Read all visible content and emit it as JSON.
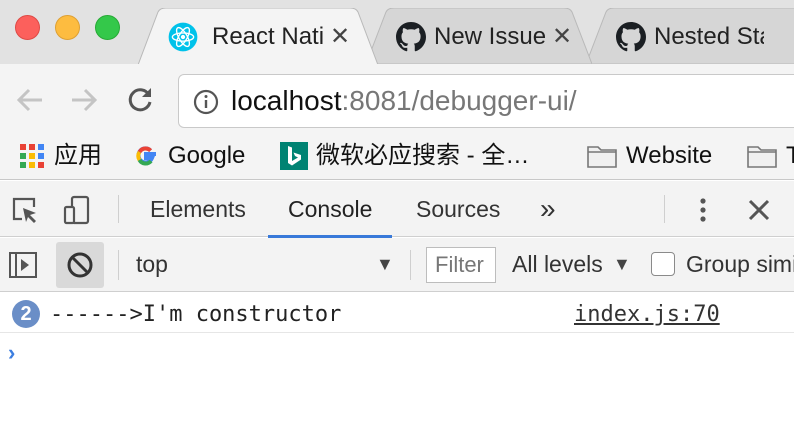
{
  "window": {
    "traffic_lights": [
      "close",
      "minimize",
      "zoom"
    ]
  },
  "tabs": [
    {
      "title": "React Native Debugger",
      "icon": "react-icon",
      "active": true
    },
    {
      "title": "New Issue",
      "icon": "github-icon",
      "active": false
    },
    {
      "title": "Nested Stack",
      "icon": "github-icon",
      "active": false
    }
  ],
  "toolbar": {
    "back_icon": "back-arrow-icon",
    "forward_icon": "forward-arrow-icon",
    "reload_icon": "reload-icon",
    "url_host": "localhost",
    "url_rest": ":8081/debugger-ui/"
  },
  "bookmarks": [
    {
      "label": "应用",
      "icon": "apps-grid-icon"
    },
    {
      "label": "Google",
      "icon": "google-icon"
    },
    {
      "label": "微软必应搜索 - 全…",
      "icon": "bing-icon"
    },
    {
      "label": "Website",
      "icon": "folder-icon"
    },
    {
      "label": "T",
      "icon": "folder-icon"
    }
  ],
  "devtools": {
    "tabs": [
      "Elements",
      "Console",
      "Sources"
    ],
    "active_tab": "Console",
    "more_tabs": "»",
    "menu_icon": "kebab-menu-icon",
    "close_icon": "close-icon"
  },
  "console_bar": {
    "context": "top",
    "filter_placeholder": "Filter",
    "levels": "All levels",
    "group_label": "Group similar",
    "group_checked": false
  },
  "messages": [
    {
      "count": "2",
      "text": "------>I'm constructor",
      "source": "index.js:70"
    }
  ],
  "prompt": "›",
  "colors": {
    "accent": "#3879d9",
    "badge": "#6a8ec7",
    "tab_strip": "#e2e2e2",
    "toolbar": "#f4f4f4"
  }
}
